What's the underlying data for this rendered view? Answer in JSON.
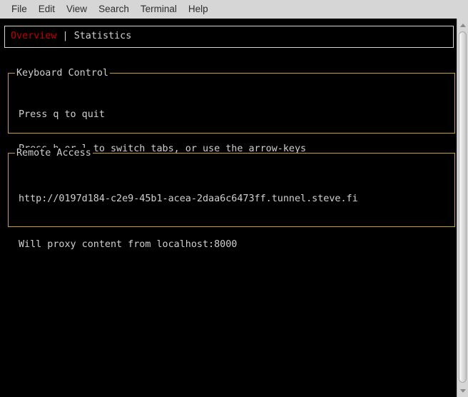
{
  "menubar": {
    "items": [
      {
        "label": "File"
      },
      {
        "label": "Edit"
      },
      {
        "label": "View"
      },
      {
        "label": "Search"
      },
      {
        "label": "Terminal"
      },
      {
        "label": "Help"
      }
    ]
  },
  "colors": {
    "menubar_background": "#d6d6d6",
    "terminal_background": "#000000",
    "terminal_foreground": "#d0d0d0",
    "panel_border": "#c9a227",
    "tabbox_border": "#d8d8d8",
    "active_tab": "#c00000"
  },
  "tabs": {
    "active_label": "Overview",
    "separator": " | ",
    "inactive_label": "Statistics"
  },
  "panels": [
    {
      "title": "Keyboard Control",
      "lines": [
        "Press q to quit",
        "Press h or l to switch tabs, or use the arrow-keys"
      ]
    },
    {
      "title": "Remote Access",
      "lines": [
        "http://0197d184-c2e9-45b1-acea-2daa6c6473ff.tunnel.steve.fi",
        "Will proxy content from localhost:8000"
      ]
    }
  ],
  "scrollbar": {
    "up_arrow": "scroll-up-arrow",
    "down_arrow": "scroll-down-arrow"
  }
}
